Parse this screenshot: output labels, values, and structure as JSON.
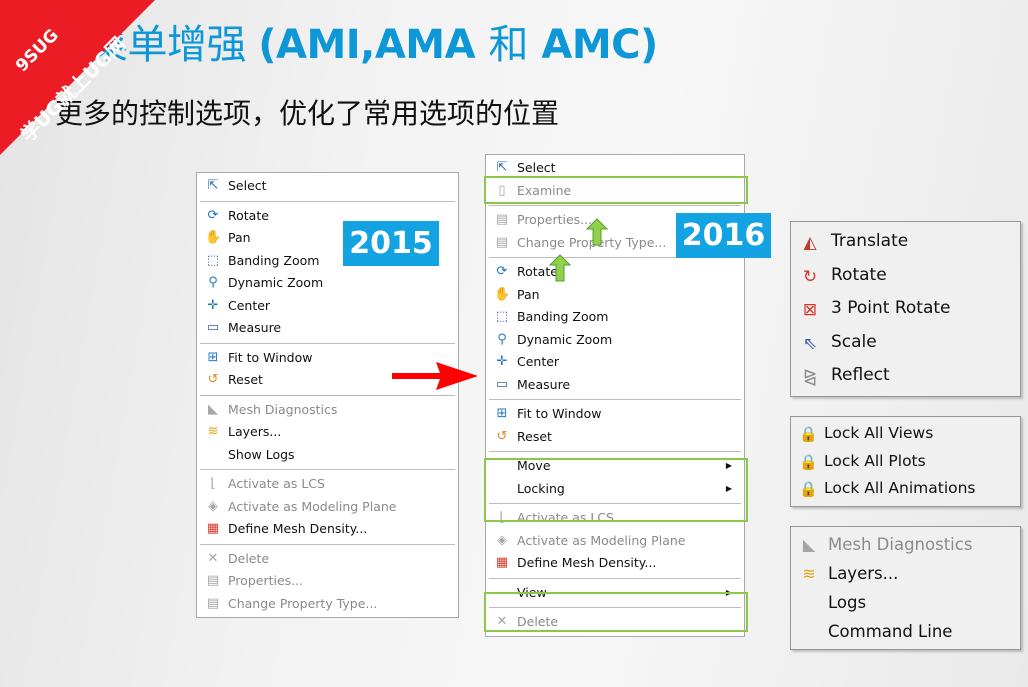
{
  "slide": {
    "title": "菜单增强 (AMI,AMA 和 AMC)",
    "title_parts": {
      "cn": "菜单增强 ",
      "en": "(AMI,AMA ",
      "he": "和",
      "en2": " AMC)"
    },
    "subtitle": "更多的控制选项，优化了常用选项的位置",
    "banner": {
      "line1": "9SUG",
      "line2": "学UG就上UG网"
    },
    "colors": {
      "title": "#0e97d7",
      "year_badge": "#13a3e3",
      "highlight": "#8bc74a",
      "banner": "#ec1c24",
      "arrow": "#ff0000"
    }
  },
  "menu2015": {
    "badge": "2015",
    "items": [
      {
        "icon": "select-icon",
        "label": "Select",
        "disabled": false
      },
      {
        "sep": true
      },
      {
        "icon": "rotate-icon",
        "label": "Rotate",
        "disabled": false
      },
      {
        "icon": "pan-icon",
        "label": "Pan",
        "disabled": false
      },
      {
        "icon": "banding-zoom-icon",
        "label": "Banding Zoom",
        "disabled": false
      },
      {
        "icon": "dynamic-zoom-icon",
        "label": "Dynamic Zoom",
        "disabled": false
      },
      {
        "icon": "center-icon",
        "label": "Center",
        "disabled": false
      },
      {
        "icon": "measure-icon",
        "label": "Measure",
        "disabled": false
      },
      {
        "sep": true
      },
      {
        "icon": "fit-to-window-icon",
        "label": "Fit to Window",
        "disabled": false
      },
      {
        "icon": "reset-icon",
        "label": "Reset",
        "disabled": false
      },
      {
        "sep": true
      },
      {
        "icon": "mesh-diagnostics-icon",
        "label": "Mesh Diagnostics",
        "disabled": true
      },
      {
        "icon": "layers-icon",
        "label": "Layers...",
        "disabled": false
      },
      {
        "icon": "",
        "label": "Show Logs",
        "disabled": false
      },
      {
        "sep": true
      },
      {
        "icon": "activate-lcs-icon",
        "label": "Activate as LCS",
        "disabled": true
      },
      {
        "icon": "modeling-plane-icon",
        "label": "Activate as Modeling Plane",
        "disabled": true
      },
      {
        "icon": "mesh-density-icon",
        "label": "Define Mesh Density...",
        "disabled": false
      },
      {
        "sep": true
      },
      {
        "icon": "delete-icon",
        "label": "Delete",
        "disabled": true
      },
      {
        "icon": "properties-icon",
        "label": "Properties...",
        "disabled": true
      },
      {
        "icon": "change-property-type-icon",
        "label": "Change Property Type...",
        "disabled": true
      }
    ]
  },
  "menu2016": {
    "badge": "2016",
    "items": [
      {
        "icon": "select-icon",
        "label": "Select",
        "disabled": false
      },
      {
        "icon": "examine-icon",
        "label": "Examine",
        "disabled": true
      },
      {
        "sep": true
      },
      {
        "icon": "properties-icon",
        "label": "Properties...",
        "disabled": true
      },
      {
        "icon": "change-property-type-icon",
        "label": "Change Property Type...",
        "disabled": true
      },
      {
        "sep": true
      },
      {
        "icon": "rotate-icon",
        "label": "Rotate",
        "disabled": false
      },
      {
        "icon": "pan-icon",
        "label": "Pan",
        "disabled": false
      },
      {
        "icon": "banding-zoom-icon",
        "label": "Banding Zoom",
        "disabled": false
      },
      {
        "icon": "dynamic-zoom-icon",
        "label": "Dynamic Zoom",
        "disabled": false
      },
      {
        "icon": "center-icon",
        "label": "Center",
        "disabled": false
      },
      {
        "icon": "measure-icon",
        "label": "Measure",
        "disabled": false
      },
      {
        "sep": true
      },
      {
        "icon": "fit-to-window-icon",
        "label": "Fit to Window",
        "disabled": false
      },
      {
        "icon": "reset-icon",
        "label": "Reset",
        "disabled": false
      },
      {
        "sep": true
      },
      {
        "icon": "",
        "label": "Move",
        "disabled": false,
        "submenu": true
      },
      {
        "icon": "",
        "label": "Locking",
        "disabled": false,
        "submenu": true
      },
      {
        "sep": true
      },
      {
        "icon": "activate-lcs-icon",
        "label": "Activate as LCS",
        "disabled": true
      },
      {
        "icon": "modeling-plane-icon",
        "label": "Activate as Modeling Plane",
        "disabled": true
      },
      {
        "icon": "mesh-density-icon",
        "label": "Define Mesh Density...",
        "disabled": false
      },
      {
        "sep": true
      },
      {
        "icon": "",
        "label": "View",
        "disabled": false,
        "submenu": true
      },
      {
        "sep": true
      },
      {
        "icon": "delete-icon",
        "label": "Delete",
        "disabled": true
      }
    ]
  },
  "move_submenu": {
    "items": [
      {
        "icon": "translate-icon",
        "label": "Translate"
      },
      {
        "icon": "rotate-move-icon",
        "label": "Rotate"
      },
      {
        "icon": "three-point-rotate-icon",
        "label": "3 Point Rotate"
      },
      {
        "icon": "scale-icon",
        "label": "Scale"
      },
      {
        "icon": "reflect-icon",
        "label": "Reflect"
      }
    ]
  },
  "locking_submenu": {
    "items": [
      {
        "icon": "lock-all-views-icon",
        "label": "Lock All Views"
      },
      {
        "icon": "lock-all-plots-icon",
        "label": "Lock All Plots"
      },
      {
        "icon": "lock-all-animations-icon",
        "label": "Lock All Animations"
      }
    ]
  },
  "view_submenu": {
    "items": [
      {
        "icon": "mesh-diagnostics-icon",
        "label": "Mesh Diagnostics",
        "disabled": true
      },
      {
        "icon": "layers-icon",
        "label": "Layers...",
        "disabled": false
      },
      {
        "icon": "",
        "label": "Logs",
        "disabled": false
      },
      {
        "icon": "",
        "label": "Command Line",
        "disabled": false
      }
    ]
  }
}
